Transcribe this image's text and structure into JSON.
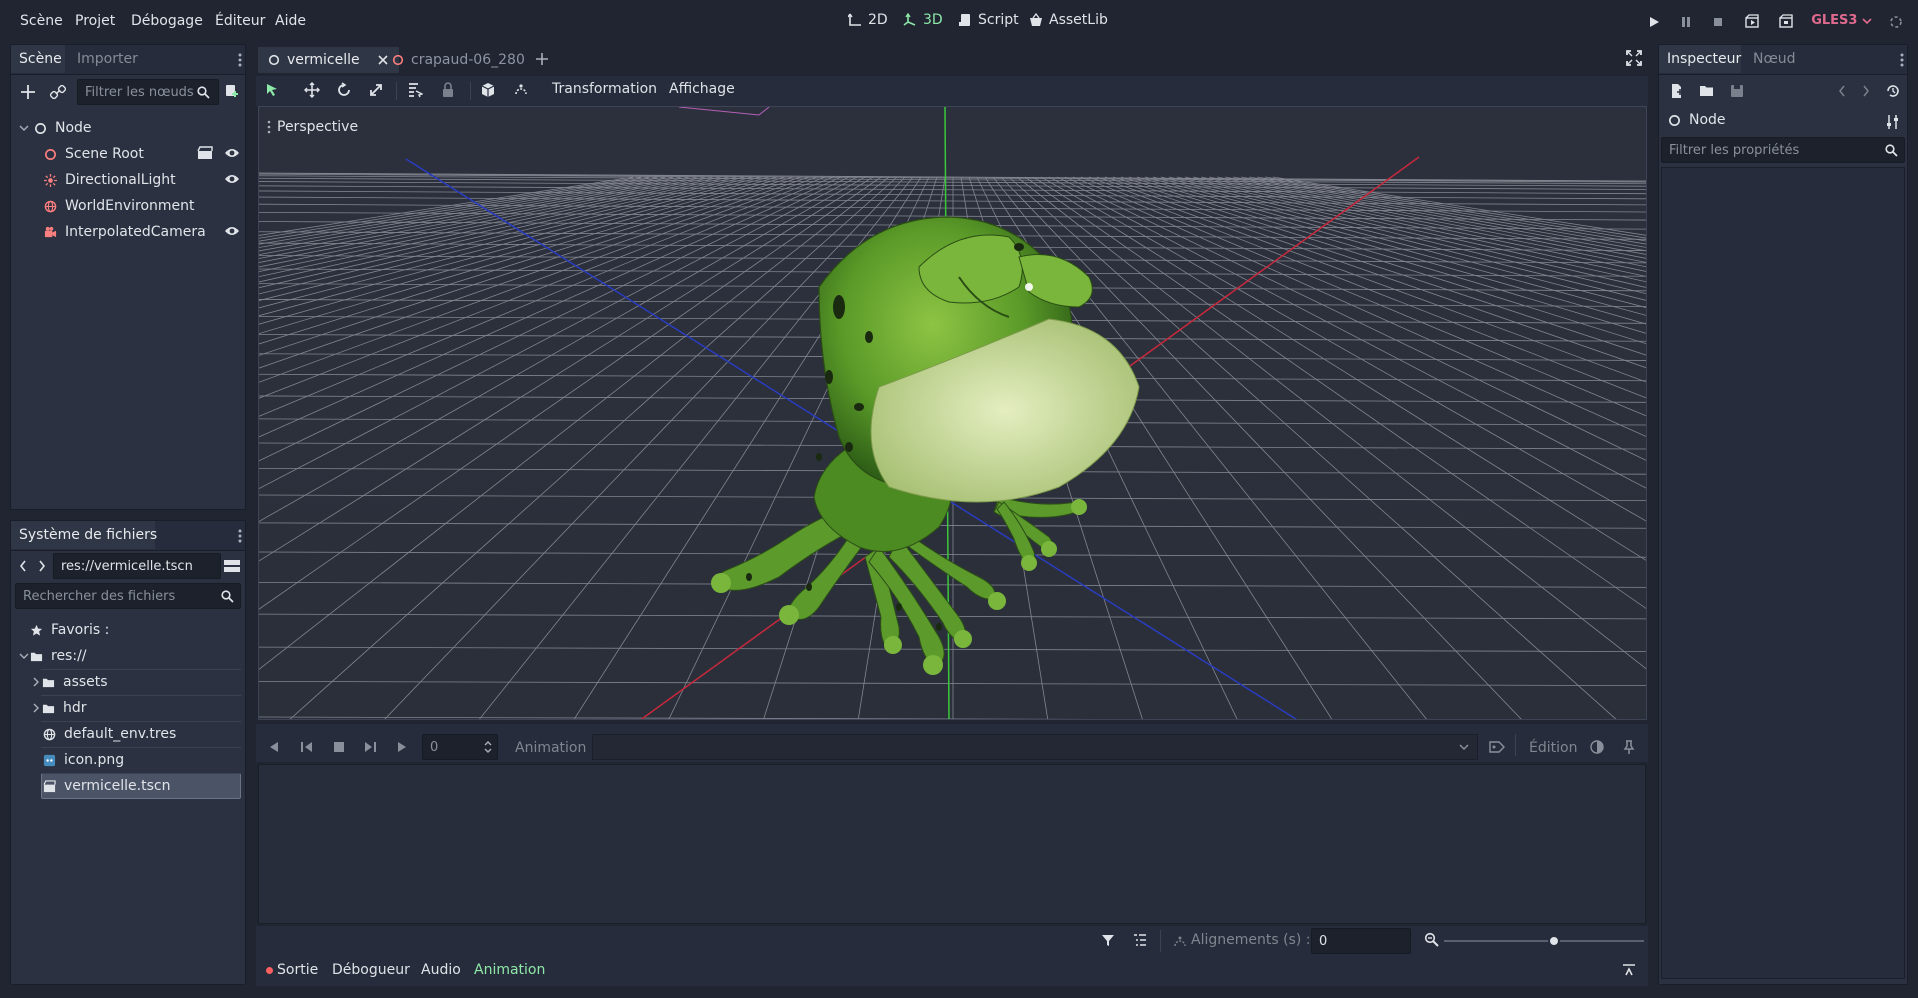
{
  "menu": {
    "items": [
      "Scène",
      "Projet",
      "Débogage",
      "Éditeur",
      "Aide"
    ]
  },
  "workspaces": {
    "b2d": "2D",
    "b3d": "3D",
    "script": "Script",
    "assetlib": "AssetLib"
  },
  "renderer": "GLES3",
  "scene_dock": {
    "tab_scene": "Scène",
    "tab_import": "Importer",
    "filter_placeholder": "Filtrer les nœuds",
    "nodes": [
      "Node",
      "Scene Root",
      "DirectionalLight",
      "WorldEnvironment",
      "InterpolatedCamera"
    ]
  },
  "filesystem": {
    "title": "Système de fichiers",
    "path": "res://vermicelle.tscn",
    "search_placeholder": "Rechercher des fichiers",
    "items": [
      "Favoris :",
      "res://",
      "assets",
      "hdr",
      "default_env.tres",
      "icon.png",
      "vermicelle.tscn"
    ]
  },
  "doc_tabs": {
    "tab1": "vermicelle",
    "tab2": "crapaud-06_280"
  },
  "toolbar": {
    "transformation": "Transformation",
    "affichage": "Affichage"
  },
  "viewport": {
    "perspective_label": "Perspective"
  },
  "animation_panel": {
    "time_value": "0",
    "animation_label": "Animation",
    "edition_label": "Édition",
    "snap_label": "Alignements (s) :",
    "snap_value": "0",
    "zoom_level": 0.55
  },
  "bottom_tabs": {
    "sortie": "Sortie",
    "debugger": "Débogueur",
    "audio": "Audio",
    "animation": "Animation"
  },
  "inspector": {
    "tab_inspector": "Inspecteur",
    "tab_node": "Nœud",
    "node_name": "Node",
    "filter_placeholder": "Filtrer les propriétés"
  },
  "colors": {
    "accent_green": "#8ee8a8",
    "renderer_pink": "#e06a8e",
    "node_red": "#fc7f7f"
  }
}
